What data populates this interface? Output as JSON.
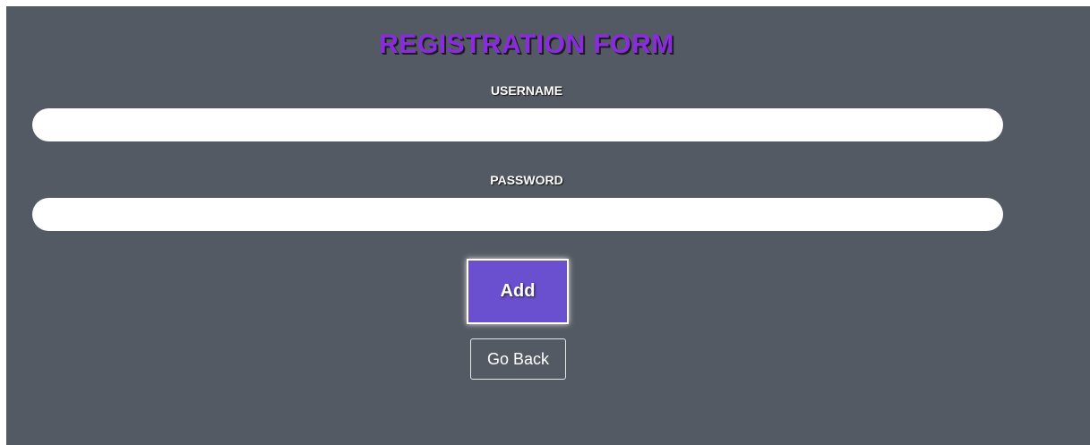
{
  "form": {
    "title": "REGISTRATION FORM",
    "username": {
      "label": "USERNAME",
      "value": "",
      "placeholder": ""
    },
    "password": {
      "label": "PASSWORD",
      "value": "",
      "placeholder": ""
    },
    "add_label": "Add",
    "back_label": "Go Back"
  },
  "colors": {
    "background": "#545a63",
    "title": "#8a2be2",
    "add_button": "#6a4fcf",
    "text": "#ffffff"
  }
}
